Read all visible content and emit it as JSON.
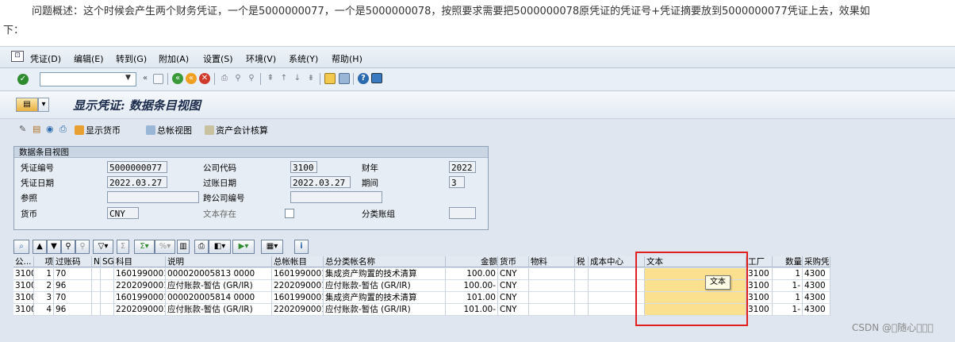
{
  "intro": {
    "line1": "问题概述：这个时候会产生两个财务凭证，一个是5000000077，一个是5000000078，按照要求需要把5000000078原凭证的凭证号+凭证摘要放到5000000077凭证上去，效果如",
    "line2": "下："
  },
  "menu": [
    "凭证(D)",
    "编辑(E)",
    "转到(G)",
    "附加(A)",
    "设置(S)",
    "环境(V)",
    "系统(Y)",
    "帮助(H)"
  ],
  "toolbar": {
    "command_value": "",
    "back_glyph": "«"
  },
  "title": {
    "text": "显示凭证: 数据条目视图"
  },
  "app_toolbar": {
    "display_currency": "显示货币",
    "gl_view": "总帐视图",
    "asset_acct": "资产会计核算"
  },
  "header": {
    "group_title": "数据条目视图",
    "doc_no_label": "凭证编号",
    "doc_no": "5000000077",
    "company_label": "公司代码",
    "company": "3100",
    "fiscal_year_label": "财年",
    "fiscal_year": "2022",
    "doc_date_label": "凭证日期",
    "doc_date": "2022.03.27",
    "posting_date_label": "过账日期",
    "posting_date": "2022.03.27",
    "period_label": "期间",
    "period": "3",
    "ref_label": "参照",
    "ref": "",
    "cross_cc_label": "跨公司编号",
    "cross_cc": "",
    "currency_label": "货币",
    "currency": "CNY",
    "text_exists_label": "文本存在",
    "ledger_group_label": "分类账组",
    "ledger_group": ""
  },
  "grid": {
    "columns": [
      "公...",
      "项",
      "过账码",
      "N!",
      "SG",
      "科目",
      "说明",
      "总帐帐目",
      "总分类帐名称",
      "金额",
      "货币",
      "物料",
      "税",
      "成本中心",
      "文本",
      "工厂",
      "数量",
      "采购凭"
    ],
    "rows": [
      {
        "cc": "3100",
        "item": "1",
        "pk": "70",
        "account": "1601990001",
        "desc": "000020005813 0000",
        "gl": "1601990001",
        "gl_name": "集成资产购置的技术清算",
        "amount": "100.00",
        "currency": "CNY",
        "text": "",
        "plant": "3100",
        "qty": "1",
        "po": "4300"
      },
      {
        "cc": "3100",
        "item": "2",
        "pk": "96",
        "account": "2202090001",
        "desc": "应付账款-暂估 (GR/IR)",
        "gl": "2202090001",
        "gl_name": "应付账款-暂估 (GR/IR)",
        "amount": "100.00-",
        "currency": "CNY",
        "text": "",
        "plant": "3100",
        "qty": "1-",
        "po": "4300"
      },
      {
        "cc": "3100",
        "item": "3",
        "pk": "70",
        "account": "1601990001",
        "desc": "000020005814 0000",
        "gl": "1601990001",
        "gl_name": "集成资产购置的技术清算",
        "amount": "101.00",
        "currency": "CNY",
        "text": "",
        "plant": "3100",
        "qty": "1",
        "po": "4300"
      },
      {
        "cc": "3100",
        "item": "4",
        "pk": "96",
        "account": "2202090001",
        "desc": "应付账款-暂估 (GR/IR)",
        "gl": "2202090001",
        "gl_name": "应付账款-暂估 (GR/IR)",
        "amount": "101.00-",
        "currency": "CNY",
        "text": "",
        "plant": "3100",
        "qty": "1-",
        "po": "4300"
      }
    ]
  },
  "tooltip": "文本",
  "watermark": "CSDN @\u0000随心\u0000\u0000\u0000",
  "colors": {
    "highlight": "#fbe08f",
    "annotation": "#e02020",
    "check": "#2e8b2e"
  }
}
